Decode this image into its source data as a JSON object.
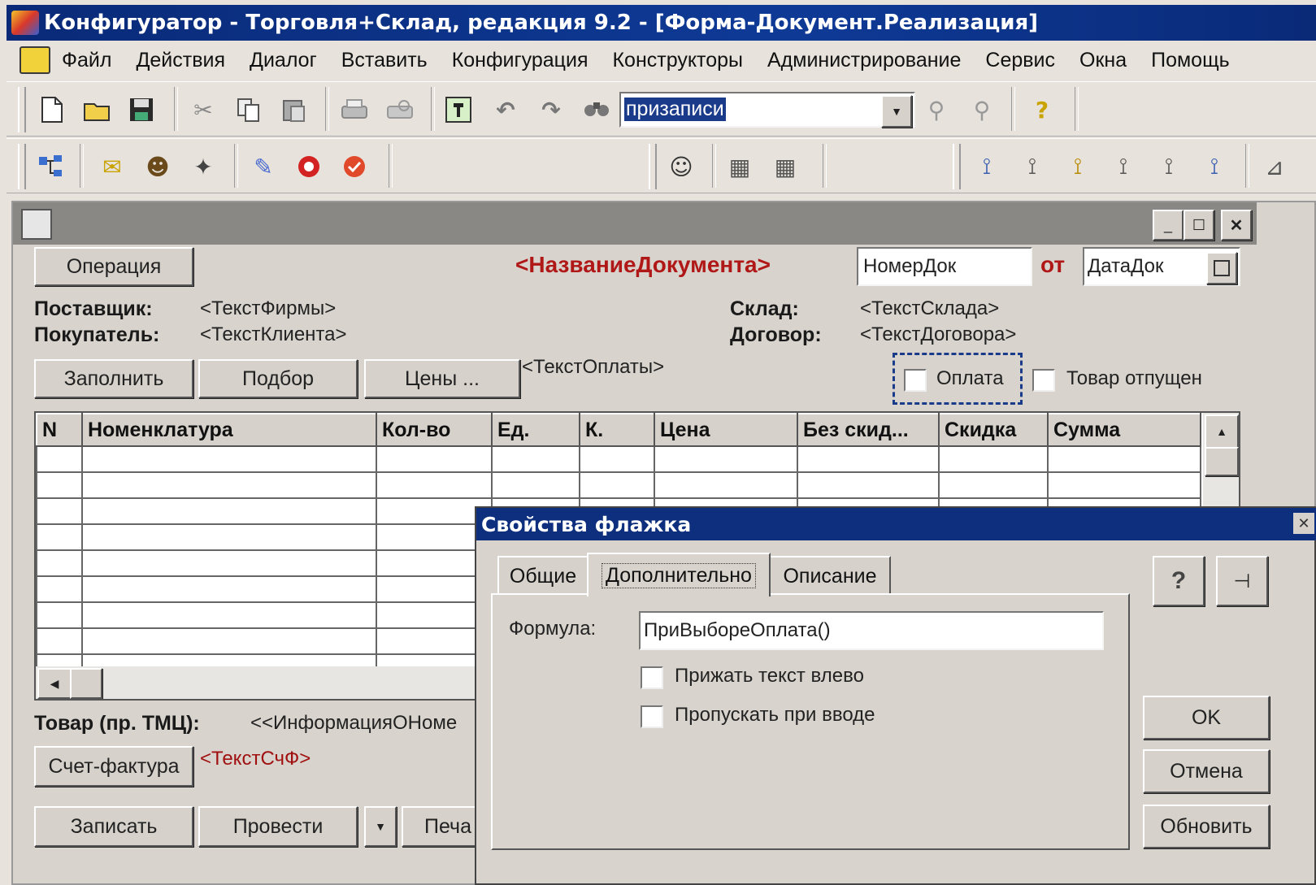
{
  "window": {
    "title": "Конфигуратор - Торговля+Склад, редакция 9.2 - [Форма-Документ.Реализация]"
  },
  "menu": [
    "Файл",
    "Действия",
    "Диалог",
    "Вставить",
    "Конфигурация",
    "Конструкторы",
    "Администрирование",
    "Сервис",
    "Окна",
    "Помощь"
  ],
  "toolbar": {
    "search_value": "призаписи",
    "help_glyph": "?"
  },
  "form": {
    "operation_button": "Операция",
    "doc_name": "<НазваниеДокумента>",
    "doc_number": "НомерДок",
    "from_label": "от",
    "doc_date": "ДатаДок",
    "supplier_label": "Поставщик:",
    "supplier_value": "<ТекстФирмы>",
    "buyer_label": "Покупатель:",
    "buyer_value": "<ТекстКлиента>",
    "warehouse_label": "Склад:",
    "warehouse_value": "<ТекстСклада>",
    "contract_label": "Договор:",
    "contract_value": "<ТекстДоговора>",
    "fill_button": "Заполнить",
    "select_button": "Подбор",
    "prices_button": "Цены ...",
    "payment_text": "<ТекстОплаты>",
    "payment_checkbox": "Оплата",
    "shipped_checkbox": "Товар отпущен",
    "table": {
      "columns": [
        "N",
        "Номенклатура",
        "Кол-во",
        "Ед.",
        "К.",
        "Цена",
        "Без скид...",
        "Скидка",
        "Сумма"
      ],
      "rows": 9
    },
    "goods_label": "Товар (пр. ТМЦ):",
    "goods_value": "<<ИнформацияОНоме",
    "invoice_button": "Счет-фактура",
    "invoice_text": "<ТекстСчФ>",
    "save_button": "Записать",
    "post_button": "Провести",
    "print_button": "Печа"
  },
  "dialog": {
    "title": "Свойства флажка",
    "tabs": [
      "Общие",
      "Дополнительно",
      "Описание"
    ],
    "formula_label": "Формула:",
    "formula_value": "ПриВыбореОплата()",
    "check_left": "Прижать текст влево",
    "check_skip": "Пропускать при вводе",
    "ok_button": "OK",
    "cancel_button": "Отмена",
    "refresh_button": "Обновить",
    "help_glyph": "?"
  },
  "colors": {
    "title_bar": "#0a2a78",
    "doc_name": "#b01818",
    "invoice_text": "#a01010",
    "selection": "#1a3a8a"
  }
}
